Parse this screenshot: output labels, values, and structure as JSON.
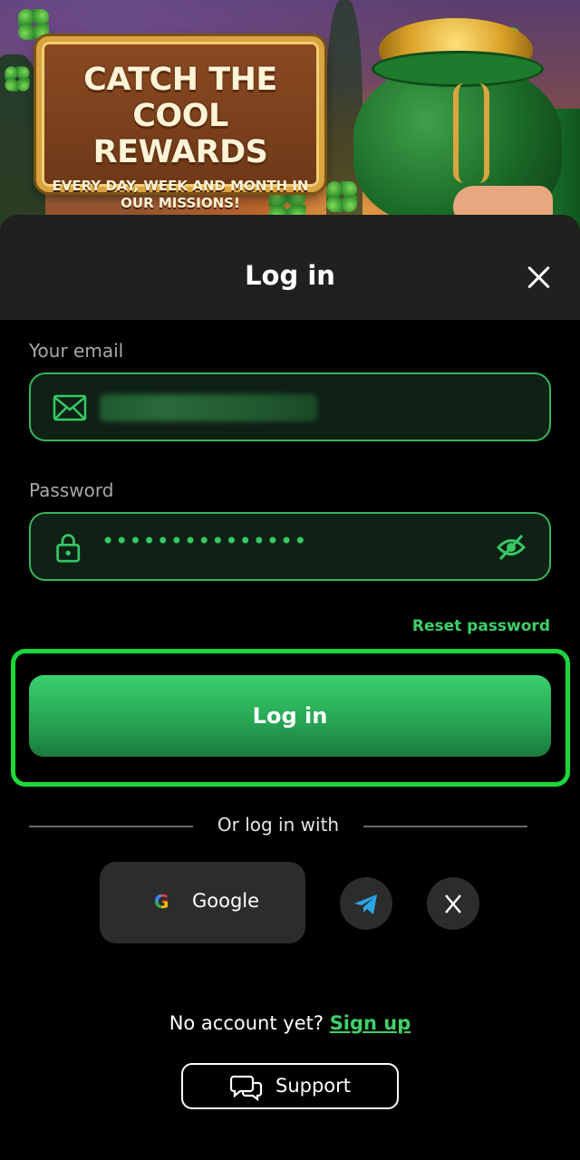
{
  "banner": {
    "title": "CATCH THE COOL REWARDS",
    "subtitle": "EVERY DAY, WEEK AND MONTH IN OUR MISSIONS!"
  },
  "dialog": {
    "title": "Log in",
    "close_icon": "close-icon"
  },
  "email": {
    "label": "Your email",
    "value": "",
    "icon": "envelope-icon"
  },
  "password": {
    "label": "Password",
    "value": "•••••••••••••••",
    "icon": "lock-icon",
    "toggle_icon": "eye-off-icon"
  },
  "reset_link": "Reset password",
  "login_button": "Log in",
  "divider_text": "Or log in with",
  "social": {
    "google_label": "Google",
    "google_icon": "google-g-icon",
    "telegram_icon": "telegram-icon",
    "x_icon": "x-logo-icon"
  },
  "signup": {
    "prompt": "No account yet?",
    "link": "Sign up"
  },
  "support": {
    "label": "Support",
    "icon": "chat-bubbles-icon"
  },
  "colors": {
    "accent": "#3fd06a",
    "highlight": "#1cd83a",
    "sheet": "#000000",
    "header": "#202020"
  }
}
